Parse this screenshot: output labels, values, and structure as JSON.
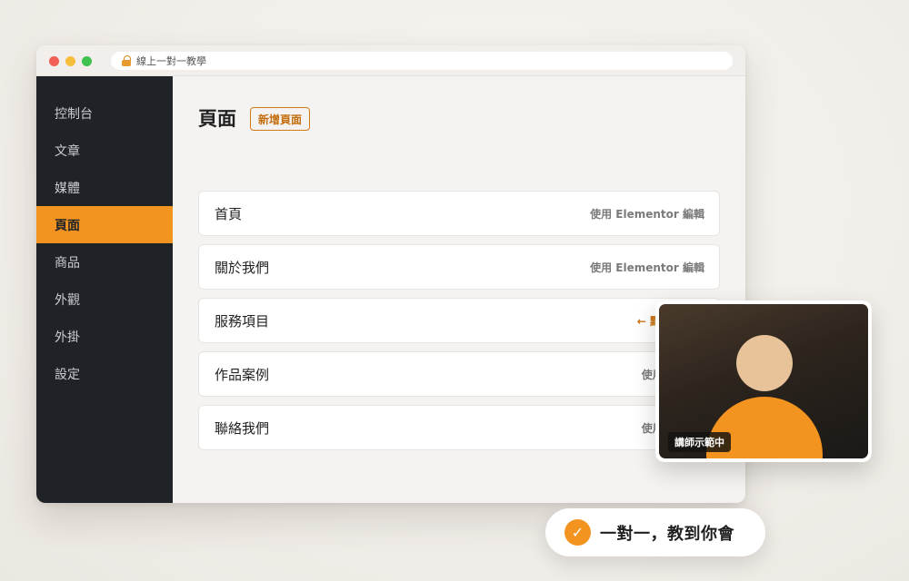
{
  "browser": {
    "url_text": "線上一對一教學",
    "icons": {
      "lock": "lock-icon"
    }
  },
  "sidebar": {
    "items": [
      {
        "label": "控制台",
        "active": false
      },
      {
        "label": "文章",
        "active": false
      },
      {
        "label": "媒體",
        "active": false
      },
      {
        "label": "頁面",
        "active": true
      },
      {
        "label": "商品",
        "active": false
      },
      {
        "label": "外觀",
        "active": false
      },
      {
        "label": "外掛",
        "active": false
      },
      {
        "label": "設定",
        "active": false
      }
    ]
  },
  "main": {
    "title": "頁面",
    "add_button": "新增頁面",
    "pages": [
      {
        "title": "首頁",
        "action": "使用 Elementor 編輯"
      },
      {
        "title": "關於我們",
        "action": "使用 Elementor 編輯"
      },
      {
        "title": "服務項目",
        "action": "← 點這裡改字"
      },
      {
        "title": "作品案例",
        "action": "使用 Eleme"
      },
      {
        "title": "聯絡我們",
        "action": "使用 Eleme"
      }
    ]
  },
  "video": {
    "badge": "講師示範中"
  },
  "pill": {
    "text": "一對一，教到你會",
    "check_icon": "✓"
  },
  "colors": {
    "accent": "#f39320",
    "sidebar_bg": "#1f2328",
    "hint_text": "#c97410"
  }
}
